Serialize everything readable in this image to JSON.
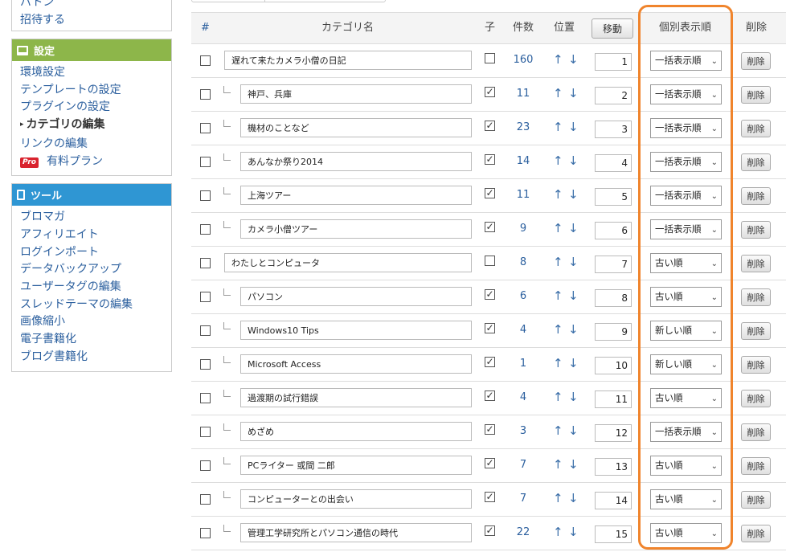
{
  "sidebar": {
    "top_links": [
      "バトン",
      "招待する"
    ],
    "settings": {
      "title": "設定",
      "items": [
        "環境設定",
        "テンプレートの設定",
        "プラグインの設定",
        "カテゴリの編集",
        "リンクの編集"
      ],
      "pro_badge": "Pro",
      "pro_label": "有料プラン"
    },
    "tools": {
      "title": "ツール",
      "items": [
        "ブロマガ",
        "アフィリエイト",
        "ログインポート",
        "データバックアップ",
        "ユーザータグの編集",
        "スレッドテーマの編集",
        "画像縮小",
        "電子書籍化",
        "ブログ書籍化"
      ]
    }
  },
  "table": {
    "headers": {
      "hash": "#",
      "name": "カテゴリ名",
      "child": "子",
      "count": "件数",
      "position": "位置",
      "move": "移動",
      "order": "個別表示順",
      "delete": "削除"
    },
    "up_arrow": "↑",
    "down_arrow": "↓",
    "delete_label": "削除",
    "rows": [
      {
        "name": "遅れて来たカメラ小僧の日記",
        "child": false,
        "count": "160",
        "pos": "1",
        "order": "一括表示順"
      },
      {
        "name": "神戸、兵庫",
        "child": true,
        "count": "11",
        "pos": "2",
        "order": "一括表示順"
      },
      {
        "name": "機材のことなど",
        "child": true,
        "count": "23",
        "pos": "3",
        "order": "一括表示順"
      },
      {
        "name": "あんなか祭り2014",
        "child": true,
        "count": "14",
        "pos": "4",
        "order": "一括表示順"
      },
      {
        "name": "上海ツアー",
        "child": true,
        "count": "11",
        "pos": "5",
        "order": "一括表示順"
      },
      {
        "name": "カメラ小僧ツアー",
        "child": true,
        "count": "9",
        "pos": "6",
        "order": "一括表示順"
      },
      {
        "name": "わたしとコンピュータ",
        "child": false,
        "count": "8",
        "pos": "7",
        "order": "古い順"
      },
      {
        "name": "パソコン",
        "child": true,
        "count": "6",
        "pos": "8",
        "order": "古い順"
      },
      {
        "name": "Windows10 Tips",
        "child": true,
        "count": "4",
        "pos": "9",
        "order": "新しい順"
      },
      {
        "name": "Microsoft Access",
        "child": true,
        "count": "1",
        "pos": "10",
        "order": "新しい順"
      },
      {
        "name": "過渡期の試行錯誤",
        "child": true,
        "count": "4",
        "pos": "11",
        "order": "古い順"
      },
      {
        "name": "めざめ",
        "child": true,
        "count": "3",
        "pos": "12",
        "order": "一括表示順"
      },
      {
        "name": "PCライター 或間 二郎",
        "child": true,
        "count": "7",
        "pos": "13",
        "order": "古い順"
      },
      {
        "name": "コンピューターとの出会い",
        "child": true,
        "count": "7",
        "pos": "14",
        "order": "古い順"
      },
      {
        "name": "管理工学研究所とパソコン通信の時代",
        "child": true,
        "count": "22",
        "pos": "15",
        "order": "古い順"
      }
    ]
  },
  "colors": {
    "settings_header": "#8db64a",
    "tools_header": "#2f96d3",
    "link": "#2b5f9e",
    "highlight": "#f0842c"
  }
}
